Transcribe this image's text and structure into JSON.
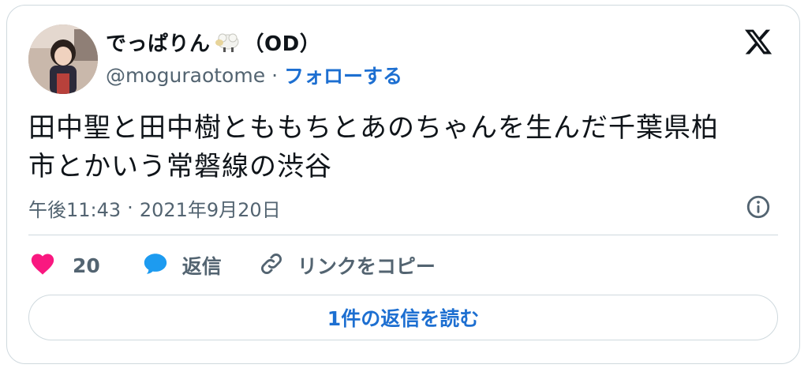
{
  "tweet": {
    "author": {
      "display_name": "でっぱりん",
      "display_suffix": "（OD）",
      "handle": "@moguraotome",
      "follow_label": "フォローする",
      "separator": "·"
    },
    "text_line1": "田中聖と田中樹とももちとあのちゃんを生んだ千葉県柏",
    "text_line2": "市とかいう常磐線の渋谷",
    "time": "午後11:43",
    "date": "2021年9月20日",
    "time_separator": "·"
  },
  "actions": {
    "like_count": "20",
    "reply_label": "返信",
    "copy_link_label": "リンクをコピー"
  },
  "read_replies_label": "1件の返信を読む",
  "colors": {
    "like": "#f91880",
    "reply": "#1d9bf0",
    "link": "#1d6fd1",
    "secondary_text": "#536471",
    "border": "#cfd9de"
  },
  "icons": {
    "brand": "x-logo-icon",
    "like": "heart-icon",
    "reply": "speech-bubble-icon",
    "copy": "link-icon",
    "info": "info-icon"
  }
}
